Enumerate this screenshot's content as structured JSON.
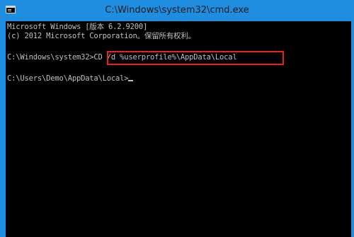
{
  "window": {
    "title": "C:\\Windows\\system32\\cmd.exe",
    "icon": "cmd-icon"
  },
  "console": {
    "lines": [
      "Microsoft Windows [版本 6.2.9200]",
      "(c) 2012 Microsoft Corporation。保留所有权利。",
      "",
      "C:\\Windows\\system32>CD /d %userprofile%\\AppData\\Local",
      "",
      "C:\\Users\\Demo\\AppData\\Local>"
    ],
    "highlighted_command": "CD /d %userprofile%\\AppData\\Local",
    "highlight_color": "#e8221c",
    "background_color": "#000000",
    "text_color": "#c0c0c0"
  },
  "colors": {
    "window_frame": "#1f8ee0"
  }
}
